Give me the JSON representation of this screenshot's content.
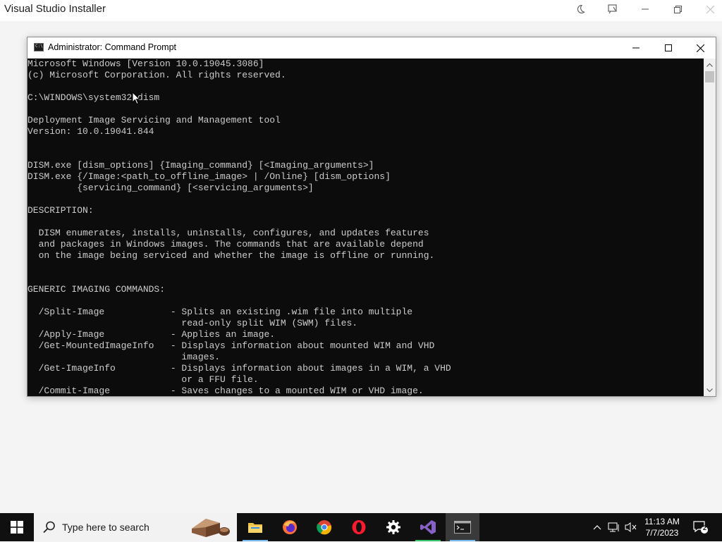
{
  "background_window": {
    "title": "Visual Studio Installer"
  },
  "cmd_window": {
    "title": "Administrator:  Command Prompt",
    "lines": [
      "Microsoft Windows [Version 10.0.19045.3086]",
      "(c) Microsoft Corporation. All rights reserved.",
      "",
      "C:\\WINDOWS\\system32>dism",
      "",
      "Deployment Image Servicing and Management tool",
      "Version: 10.0.19041.844",
      "",
      "",
      "DISM.exe [dism_options] {Imaging_command} [<Imaging_arguments>]",
      "DISM.exe {/Image:<path_to_offline_image> | /Online} [dism_options]",
      "         {servicing_command} [<servicing_arguments>]",
      "",
      "DESCRIPTION:",
      "",
      "  DISM enumerates, installs, uninstalls, configures, and updates features",
      "  and packages in Windows images. The commands that are available depend",
      "  on the image being serviced and whether the image is offline or running.",
      "",
      "",
      "GENERIC IMAGING COMMANDS:",
      "",
      "  /Split-Image            - Splits an existing .wim file into multiple",
      "                            read-only split WIM (SWM) files.",
      "  /Apply-Image            - Applies an image.",
      "  /Get-MountedImageInfo   - Displays information about mounted WIM and VHD",
      "                            images.",
      "  /Get-ImageInfo          - Displays information about images in a WIM, a VHD",
      "                            or a FFU file.",
      "  /Commit-Image           - Saves changes to a mounted WIM or VHD image."
    ]
  },
  "taskbar": {
    "search_placeholder": "Type here to search",
    "time": "11:13 AM",
    "date": "7/7/2023",
    "notification_count": "2",
    "apps": [
      "file-explorer",
      "firefox",
      "chrome",
      "opera",
      "settings",
      "visual-studio",
      "command-prompt"
    ]
  },
  "colors": {
    "console_bg": "#0c0c0c",
    "console_fg": "#cccccc",
    "taskbar_bg": "#101010",
    "accent": "#76b9ed"
  }
}
